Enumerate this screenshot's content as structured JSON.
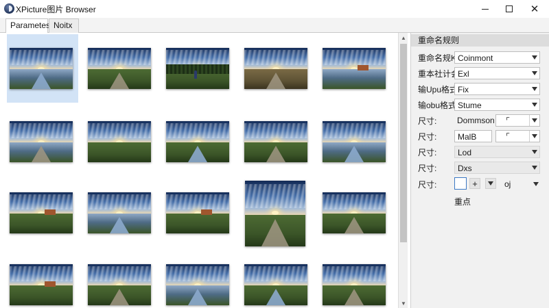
{
  "window": {
    "title": "XPicture图片 Browser",
    "controls": {
      "minimize": "minimize-icon",
      "maximize": "maximize-icon",
      "close": "✕"
    }
  },
  "tabs": [
    {
      "label": "Parametes",
      "active": true
    },
    {
      "label": "Noitx",
      "active": false
    }
  ],
  "gallery": {
    "selected_index": 0,
    "thumbnails": [
      "landscape-1",
      "landscape-2",
      "landscape-3",
      "landscape-4",
      "landscape-5",
      "landscape-6",
      "landscape-7",
      "landscape-8",
      "landscape-9",
      "landscape-10",
      "landscape-11",
      "landscape-12",
      "landscape-13",
      "landscape-14",
      "landscape-15",
      "landscape-16",
      "landscape-17",
      "landscape-18",
      "landscape-19",
      "landscape-20"
    ]
  },
  "panel": {
    "header": "重命名规则",
    "rows": [
      {
        "label": "重命名规K:",
        "value": "Coinmont"
      },
      {
        "label": "重本社计会:",
        "value": "Exl"
      },
      {
        "label": "输Upu格式",
        "value": "Fix"
      },
      {
        "label": "输obu格式",
        "value": "Stume"
      },
      {
        "label": "尺寸:",
        "value": "Dommson",
        "icon": "crop-icon"
      },
      {
        "label": "尺寸:",
        "value": "MalB",
        "icon": "aspect-icon"
      },
      {
        "label": "尺寸:",
        "value": "Lod"
      },
      {
        "label": "尺寸:",
        "value": "Dxs"
      },
      {
        "label": "尺寸:",
        "value": "",
        "plus": "+",
        "extra": "oj"
      }
    ],
    "footer_text": "重点"
  },
  "colors": {
    "accent": "#3b78c4",
    "selection": "#d2e3f6",
    "panel_bg": "#f1f1f1"
  }
}
